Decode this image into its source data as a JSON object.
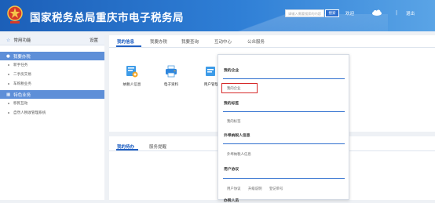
{
  "header": {
    "title": "国家税务总局重庆市电子税务局",
    "search_placeholder": "请输入需要搜索的内容",
    "search_label": "搜索",
    "welcome": "欢迎",
    "separator": "|",
    "logout": "退出",
    "colors": {
      "brand": "#1c5fb8",
      "accent": "#2f7fd6"
    }
  },
  "sidebar": {
    "header_label": "常用功能",
    "settings_label": "设置",
    "sections": [
      {
        "title": "我要办税",
        "icon": "circle-icon",
        "items": [
          "新手任务",
          "二手房交易",
          "车购税业务"
        ]
      },
      {
        "title": "特色业务",
        "icon": "grid-icon",
        "items": [
          "移民互动",
          "自然人税收管理系统"
        ]
      }
    ]
  },
  "main": {
    "tabs": [
      "我的信息",
      "我要办税",
      "我要查询",
      "互动中心",
      "公众服务"
    ],
    "active_tab": 0,
    "tiles": [
      {
        "label": "纳税人信息",
        "icon": "taxpayer-info-icon"
      },
      {
        "label": "电子资料",
        "icon": "printer-icon"
      },
      {
        "label": "用户管理",
        "icon": "user-manage-icon"
      }
    ]
  },
  "lower": {
    "tabs": [
      "我的待办",
      "服务提醒"
    ],
    "active_tab": 0
  },
  "dropdown": {
    "groups": [
      {
        "title": "我的企业",
        "items": [
          "我的企业"
        ]
      },
      {
        "title": "我的标签",
        "items": [
          "我的标签"
        ]
      },
      {
        "title": "外埠纳税人信息",
        "items": [
          "外埠纳税人信息"
        ]
      },
      {
        "title": "用户协议",
        "items": [
          "用户协议",
          "升级说明",
          "登记单号"
        ]
      },
      {
        "title": "办税人员",
        "items": []
      }
    ],
    "highlighted": "我的企业"
  }
}
